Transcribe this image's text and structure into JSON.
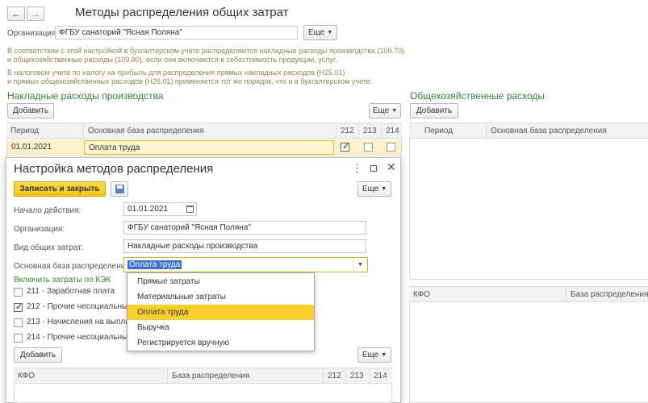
{
  "header": {
    "back_glyph": "←",
    "forward_glyph": "→",
    "title": "Методы распределения общих затрат",
    "org_label": "Организация:",
    "org_value": "ФГБУ санаторий \"Ясная Поляна\"",
    "more_label": "Еще"
  },
  "hints": {
    "line1": "В соответствии с этой настройкой в бухгалтерском учете распределяются накладные расходы производства (109.70)",
    "line2": "и общехозяйственные расходы (109.80), если они включаются в себестоимость продукции, услуг.",
    "line3": "В налоговом учете по налогу на прибыль для распределения прямых накладных расходов (Н25.01)",
    "line4": "и прямых общехозяйственных расходов (Н26.01) применяется тот же порядок, что и в бухгалтерском учете."
  },
  "overhead": {
    "title": "Накладные расходы производства",
    "add_label": "Добавить",
    "more_label": "Еще",
    "columns": [
      "Период",
      "Основная база распределения",
      "212",
      "213",
      "214"
    ],
    "rows": [
      {
        "period": "01.01.2021",
        "base": "Оплата труда",
        "c212": true,
        "c213": false,
        "c214": false
      }
    ]
  },
  "general": {
    "title": "Общехозяйственные расходы",
    "add_label": "Добавить",
    "columns": [
      "Период",
      "Основная база распределения"
    ],
    "columns2": [
      "КФО",
      "База распределения"
    ]
  },
  "dialog": {
    "title": "Настройка методов распределения",
    "save_close_label": "Записать и закрыть",
    "more_label": "Еще",
    "start_label": "Начало действия:",
    "start_value": "01.01.2021",
    "org_label": "Организация:",
    "org_value": "ФГБУ санаторий \"Ясная Поляна\"",
    "kind_label": "Вид общих затрат:",
    "kind_value": "Накладные расходы производства",
    "base_label": "Основная база распределения:",
    "base_value": "Оплата труда",
    "include_label": "Включить затраты по КЭК",
    "kek": [
      {
        "label": "211 - Заработная плата",
        "checked": false
      },
      {
        "label": "212 - Прочие несоциальные в",
        "checked": true
      },
      {
        "label": "213 - Начисления на выплаты",
        "checked": false
      },
      {
        "label": "214 - Прочие несоциальные в",
        "checked": false
      }
    ],
    "add_label": "Добавить",
    "more2_label": "Еще",
    "table_columns": [
      "КФО",
      "База распределения",
      "212",
      "213",
      "214"
    ]
  },
  "dropdown": {
    "options": [
      "Прямые затраты",
      "Материальные затраты",
      "Оплата труда",
      "Выручка",
      "Регистрируется вручную"
    ],
    "selected_index": 2
  },
  "colors": {
    "accent_yellow": "#f9d02b",
    "green_title": "#2e8b2e",
    "selection_blue": "#3a6fd8"
  }
}
